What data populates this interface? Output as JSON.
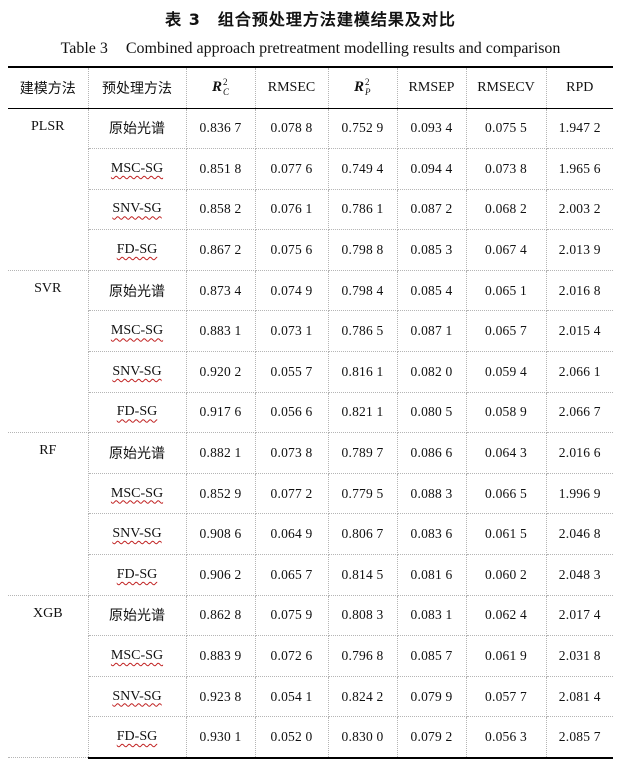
{
  "caption": {
    "cn": "表 3　组合预处理方法建模结果及对比",
    "en_label": "Table 3",
    "en_text": "Combined approach pretreatment modelling results and comparison"
  },
  "header": {
    "model": "建模方法",
    "method": "预处理方法",
    "r2c_symbol": "R",
    "r2c_sup": "2",
    "r2c_sub": "C",
    "rmsec": "RMSEC",
    "r2p_symbol": "R",
    "r2p_sup": "2",
    "r2p_sub": "P",
    "rmsep": "RMSEP",
    "rmsecv": "RMSECV",
    "rpd": "RPD"
  },
  "groups": [
    {
      "model": "PLSR",
      "rows": [
        {
          "method": "原始光谱",
          "r2c": "0.836 7",
          "rmsec": "0.078 8",
          "r2p": "0.752 9",
          "rmsep": "0.093 4",
          "rmsecv": "0.075 5",
          "rpd": "1.947 2"
        },
        {
          "method": "MSC-SG",
          "r2c": "0.851 8",
          "rmsec": "0.077 6",
          "r2p": "0.749 4",
          "rmsep": "0.094 4",
          "rmsecv": "0.073 8",
          "rpd": "1.965 6"
        },
        {
          "method": "SNV-SG",
          "r2c": "0.858 2",
          "rmsec": "0.076 1",
          "r2p": "0.786 1",
          "rmsep": "0.087 2",
          "rmsecv": "0.068 2",
          "rpd": "2.003 2"
        },
        {
          "method": "FD-SG",
          "r2c": "0.867 2",
          "rmsec": "0.075 6",
          "r2p": "0.798 8",
          "rmsep": "0.085 3",
          "rmsecv": "0.067 4",
          "rpd": "2.013 9"
        }
      ]
    },
    {
      "model": "SVR",
      "rows": [
        {
          "method": "原始光谱",
          "r2c": "0.873 4",
          "rmsec": "0.074 9",
          "r2p": "0.798 4",
          "rmsep": "0.085 4",
          "rmsecv": "0.065 1",
          "rpd": "2.016 8"
        },
        {
          "method": "MSC-SG",
          "r2c": "0.883 1",
          "rmsec": "0.073 1",
          "r2p": "0.786 5",
          "rmsep": "0.087 1",
          "rmsecv": "0.065 7",
          "rpd": "2.015 4"
        },
        {
          "method": "SNV-SG",
          "r2c": "0.920 2",
          "rmsec": "0.055 7",
          "r2p": "0.816 1",
          "rmsep": "0.082 0",
          "rmsecv": "0.059 4",
          "rpd": "2.066 1"
        },
        {
          "method": "FD-SG",
          "r2c": "0.917 6",
          "rmsec": "0.056 6",
          "r2p": "0.821 1",
          "rmsep": "0.080 5",
          "rmsecv": "0.058 9",
          "rpd": "2.066 7"
        }
      ]
    },
    {
      "model": "RF",
      "rows": [
        {
          "method": "原始光谱",
          "r2c": "0.882 1",
          "rmsec": "0.073 8",
          "r2p": "0.789 7",
          "rmsep": "0.086 6",
          "rmsecv": "0.064 3",
          "rpd": "2.016 6"
        },
        {
          "method": "MSC-SG",
          "r2c": "0.852 9",
          "rmsec": "0.077 2",
          "r2p": "0.779 5",
          "rmsep": "0.088 3",
          "rmsecv": "0.066 5",
          "rpd": "1.996 9"
        },
        {
          "method": "SNV-SG",
          "r2c": "0.908 6",
          "rmsec": "0.064 9",
          "r2p": "0.806 7",
          "rmsep": "0.083 6",
          "rmsecv": "0.061 5",
          "rpd": "2.046 8"
        },
        {
          "method": "FD-SG",
          "r2c": "0.906 2",
          "rmsec": "0.065 7",
          "r2p": "0.814 5",
          "rmsep": "0.081 6",
          "rmsecv": "0.060 2",
          "rpd": "2.048 3"
        }
      ]
    },
    {
      "model": "XGB",
      "rows": [
        {
          "method": "原始光谱",
          "r2c": "0.862 8",
          "rmsec": "0.075 9",
          "r2p": "0.808 3",
          "rmsep": "0.083 1",
          "rmsecv": "0.062 4",
          "rpd": "2.017 4"
        },
        {
          "method": "MSC-SG",
          "r2c": "0.883 9",
          "rmsec": "0.072 6",
          "r2p": "0.796 8",
          "rmsep": "0.085 7",
          "rmsecv": "0.061 9",
          "rpd": "2.031 8"
        },
        {
          "method": "SNV-SG",
          "r2c": "0.923 8",
          "rmsec": "0.054 1",
          "r2p": "0.824 2",
          "rmsep": "0.079 9",
          "rmsecv": "0.057 7",
          "rpd": "2.081 4"
        },
        {
          "method": "FD-SG",
          "r2c": "0.930 1",
          "rmsec": "0.052 0",
          "r2p": "0.830 0",
          "rmsep": "0.079 2",
          "rmsecv": "0.056 3",
          "rpd": "2.085 7"
        }
      ]
    }
  ],
  "colors": {
    "rule": "#000000",
    "grid": "#b5b5b5",
    "spellcheck_underline": "#c02020"
  }
}
